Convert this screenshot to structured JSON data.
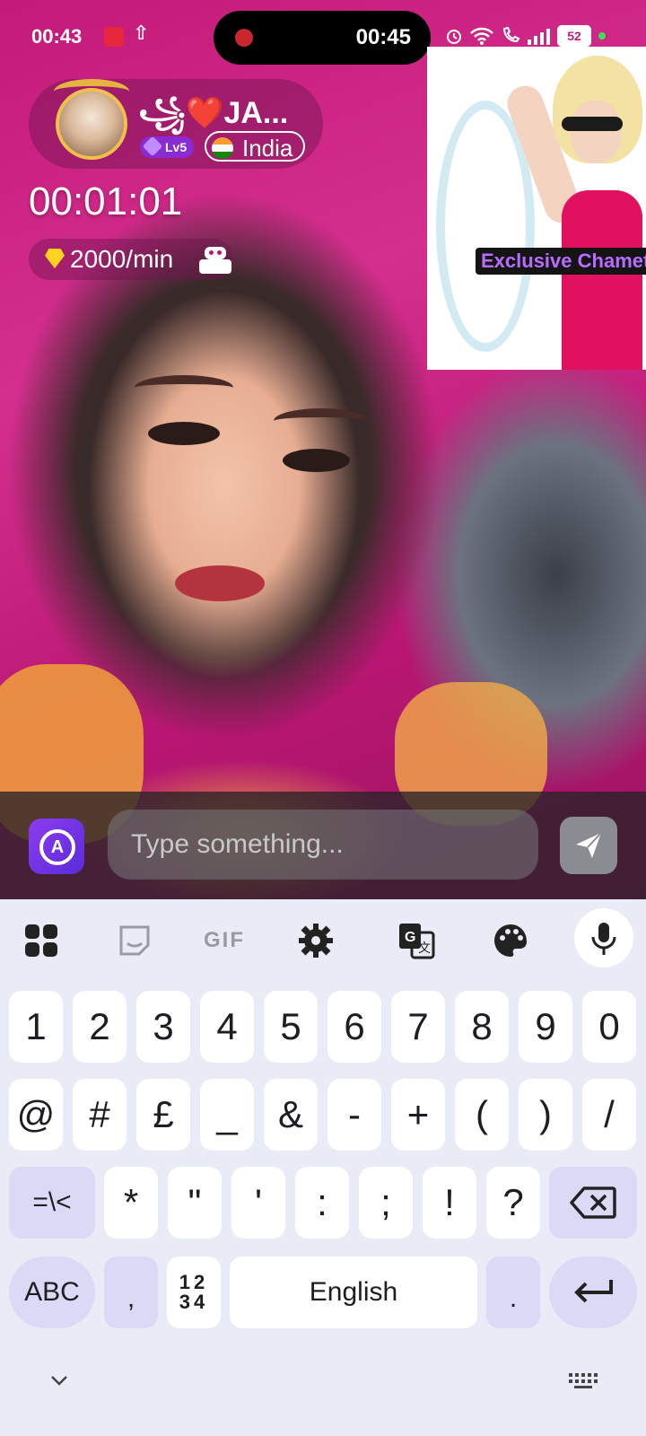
{
  "status_bar": {
    "time": "00:43",
    "upload_glyph": "⇧",
    "call_duration": "00:45",
    "battery": "52"
  },
  "caller": {
    "name": "꧁❤️JA...",
    "level": "Lv5",
    "country": "India"
  },
  "call": {
    "timer": "00:01:01",
    "rate": "2000/min"
  },
  "preview": {
    "label": "Exclusive Chamet"
  },
  "chat": {
    "placeholder": "Type something..."
  },
  "keyboard": {
    "toolbar": {
      "gif_label": "GIF"
    },
    "row_numbers": [
      "1",
      "2",
      "3",
      "4",
      "5",
      "6",
      "7",
      "8",
      "9",
      "0"
    ],
    "row_symbols_1": [
      "@",
      "#",
      "£",
      "_",
      "&",
      "-",
      "+",
      "(",
      ")",
      "/"
    ],
    "row_symbols_2": {
      "shift_label": "=\\<",
      "keys": [
        "*",
        "\"",
        "'",
        ":",
        ";",
        "!",
        "?"
      ]
    },
    "row_bottom": {
      "abc_label": "ABC",
      "comma": ",",
      "numpad_top": "12",
      "numpad_bottom": "34",
      "space_label": "English",
      "period": "."
    }
  },
  "colors": {
    "accent_purple": "#8b3df0",
    "keyboard_bg": "#e9ebf6",
    "function_key": "#dcd9f6",
    "brand_pink": "#c41a7a"
  },
  "icons": {
    "status_rec": "screen-record-icon",
    "translate": "translate-a-icon",
    "send": "send-paper-plane-icon",
    "mic": "microphone-icon",
    "backspace": "backspace-icon",
    "enter": "enter-return-icon"
  }
}
